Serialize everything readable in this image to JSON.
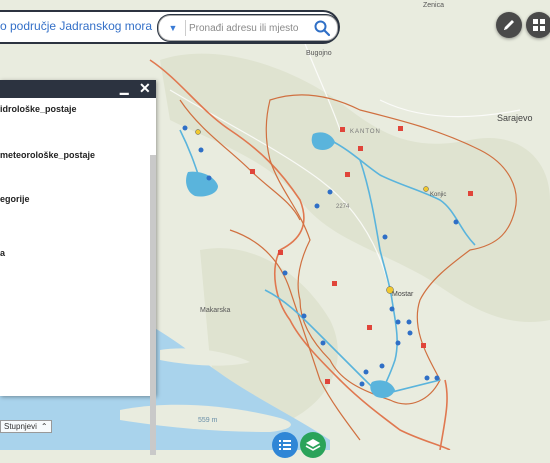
{
  "header": {
    "title": "o područje Jadranskog mora",
    "search_placeholder": "Pronađi adresu ili mjesto"
  },
  "panel": {
    "layers": [
      "idrološke_postaje",
      "meteorološke_postaje",
      "egorije",
      "a"
    ]
  },
  "map_labels": {
    "zenica": "Zenica",
    "bugojno": "Bugojno",
    "sarajevo": "Sarajevo",
    "konjic": "Konjic",
    "mostar": "Mostar",
    "makarska": "Makarska",
    "peak": "559 m",
    "area_name": "KANTON",
    "peak2": "2274"
  },
  "status": {
    "label": "Stupnjevi"
  }
}
